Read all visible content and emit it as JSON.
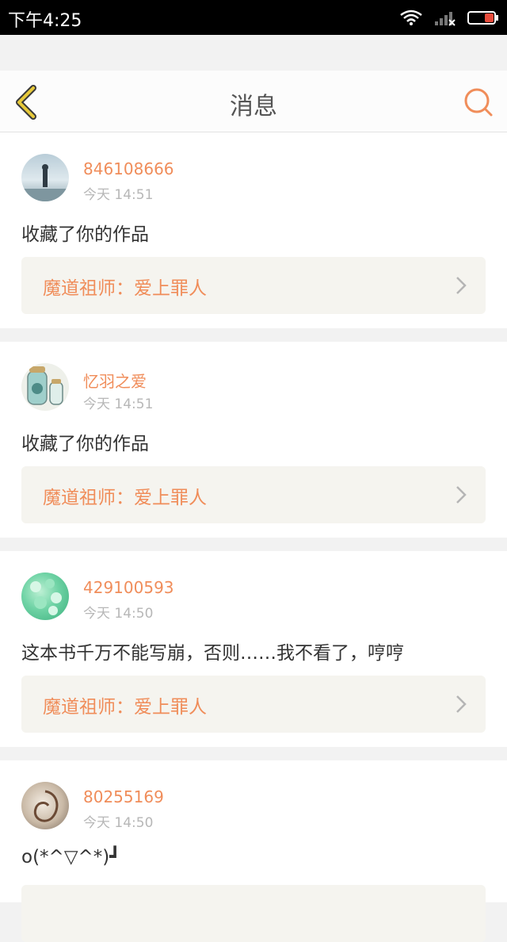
{
  "status_bar": {
    "time": "下午4:25"
  },
  "header": {
    "title": "消息"
  },
  "colors": {
    "accent": "#f08d5a",
    "back_icon": "#e7c93a",
    "work_bg": "#f5f4ef"
  },
  "messages": [
    {
      "user": "846108666",
      "time": "今天 14:51",
      "text": "收藏了你的作品",
      "work": "魔道祖师：爱上罪人"
    },
    {
      "user": "忆羽之爱",
      "time": "今天 14:51",
      "text": "收藏了你的作品",
      "work": "魔道祖师：爱上罪人"
    },
    {
      "user": "429100593",
      "time": "今天 14:50",
      "text": "这本书千万不能写崩，否则……我不看了，哼哼",
      "work": "魔道祖师：爱上罪人"
    },
    {
      "user": "80255169",
      "time": "今天 14:50",
      "text": "o(*^▽^*)┛",
      "work": ""
    }
  ]
}
